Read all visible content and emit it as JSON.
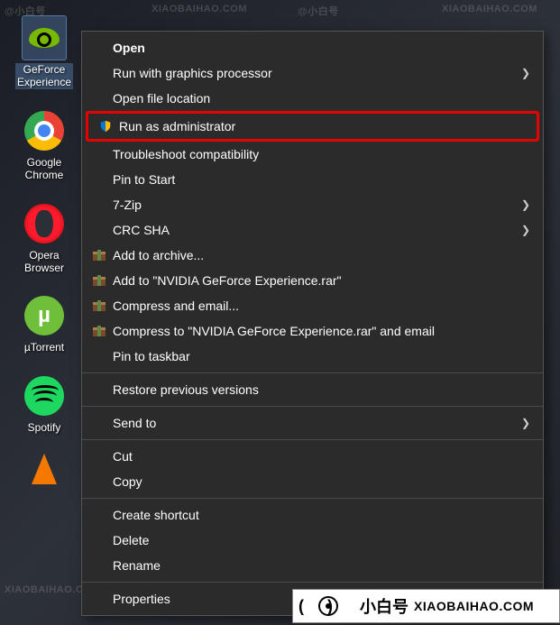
{
  "desktop": {
    "icons": [
      {
        "name": "geforce-experience",
        "label": "GeForce\nExperience",
        "selected": true
      },
      {
        "name": "google-chrome",
        "label": "Google\nChrome"
      },
      {
        "name": "opera-browser",
        "label": "Opera\nBrowser"
      },
      {
        "name": "utorrent",
        "label": "µTorrent"
      },
      {
        "name": "spotify",
        "label": "Spotify"
      },
      {
        "name": "vlc",
        "label": ""
      }
    ]
  },
  "menu": {
    "open": "Open",
    "run_gpu": "Run with graphics processor",
    "open_loc": "Open file location",
    "run_admin": "Run as administrator",
    "troubleshoot": "Troubleshoot compatibility",
    "pin_start": "Pin to Start",
    "seven_zip": "7-Zip",
    "crc_sha": "CRC SHA",
    "add_archive": "Add to archive...",
    "add_to_rar": "Add to \"NVIDIA GeForce Experience.rar\"",
    "compress_email": "Compress and email...",
    "compress_rar_email": "Compress to \"NVIDIA GeForce Experience.rar\" and email",
    "pin_taskbar": "Pin to taskbar",
    "restore": "Restore previous versions",
    "send_to": "Send to",
    "cut": "Cut",
    "copy": "Copy",
    "create_shortcut": "Create shortcut",
    "delete": "Delete",
    "rename": "Rename",
    "properties": "Properties"
  },
  "watermark": {
    "text_cn": "@小白号",
    "text_en": "XIAOBAIHAO.COM"
  },
  "footer": {
    "cn": "小白号",
    "en": "XIAOBAIHAO.COM"
  }
}
